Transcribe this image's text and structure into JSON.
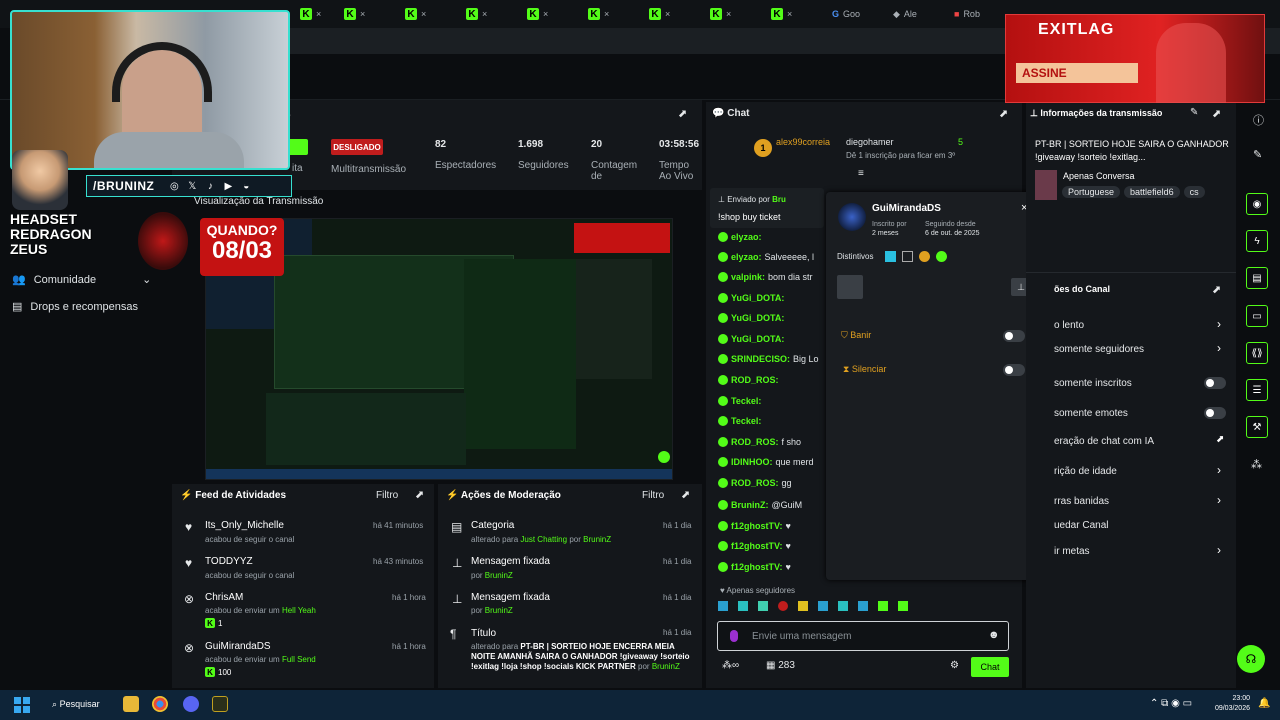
{
  "browser": {
    "tabs": [
      "Goo",
      "Ale",
      "Rob"
    ],
    "kick_tab_count": 13
  },
  "overlay": {
    "handle": "/BRUNINZ",
    "headset_lines": [
      "HEADSET",
      "REDRAGON",
      "ZEUS"
    ],
    "quando": "QUANDO?",
    "date": "08/03",
    "ad_brand": "EXITLAG",
    "ad_button": "ASSINE"
  },
  "leftnav": {
    "community": "Comunidade",
    "drops": "Drops e recompensas"
  },
  "streaminfo": {
    "desligado": "DESLIGADO",
    "multistream": "Multitransmissão",
    "viewers_value": "82",
    "viewers_label": "Espectadores",
    "followers_value": "1.698",
    "followers_label": "Seguidores",
    "count_value": "20",
    "count_label": "Contagem de",
    "time_value": "03:58:56",
    "time_label": "Tempo Ao Vivo",
    "preview_title": "Visualização da Transmissão",
    "partial_label": "o",
    "partial_left": "ita"
  },
  "feed": {
    "title": "Feed de Atividades",
    "filter": "Filtro",
    "items": [
      {
        "name": "Its_Only_Michelle",
        "sub": "acabou de seguir o canal",
        "time": "há 41 minutos"
      },
      {
        "name": "TODDYYZ",
        "sub": "acabou de seguir o canal",
        "time": "há 43 minutos"
      },
      {
        "name": "ChrisAM",
        "sub": "acabou de enviar um",
        "sub_highlight": "Hell Yeah",
        "count": "1",
        "time": "há 1 hora"
      },
      {
        "name": "GuiMirandaDS",
        "sub": "acabou de enviar um",
        "sub_highlight": "Full Send",
        "count": "100",
        "time": "há 1 hora"
      }
    ]
  },
  "modactions": {
    "title": "Ações de Moderação",
    "filter": "Filtro",
    "items": [
      {
        "title": "Categoria",
        "sub_prefix": "alterado para",
        "sub_highlight": "Just Chatting",
        "sub_mid": "por",
        "sub_user": "BruninZ",
        "time": "há 1 dia"
      },
      {
        "title": "Mensagem fixada",
        "sub_prefix": "por",
        "sub_user": "BruninZ",
        "time": "há 1 dia"
      },
      {
        "title": "Mensagem fixada",
        "sub_prefix": "por",
        "sub_user": "BruninZ",
        "time": "há 1 dia"
      },
      {
        "title": "Título",
        "sub_prefix": "alterado para",
        "sub_highlight": "PT-BR | SORTEIO HOJE ENCERRA MEIA NOITE AMANHÃ SAIRA O GANHADOR !giveaway !sorteio !exitlag !loja !shop !socials",
        "sub_mid": "KICK PARTNER",
        "sub_user": "BruninZ",
        "sub_after": "por",
        "time": "há 1 dia"
      }
    ]
  },
  "chat": {
    "title": "Chat",
    "gifters": [
      {
        "name": "alex99correia",
        "count": "1"
      },
      {
        "name": "diegohamer",
        "count": "5"
      }
    ],
    "gift_note": "Dê 1 inscrição para ficar em 3º",
    "pinned_label": "Enviado por",
    "pinned_user": "Bru",
    "pinned_msg": "!shop buy ticket",
    "lines": [
      {
        "user": "elyzao:",
        "msg": ""
      },
      {
        "user": "elyzao:",
        "msg": "Salveeeee, l"
      },
      {
        "user": "valpink:",
        "msg": "bom dia str"
      },
      {
        "user": "YuGi_DOTA:",
        "msg": ""
      },
      {
        "user": "YuGi_DOTA:",
        "msg": ""
      },
      {
        "user": "YuGi_DOTA:",
        "msg": ""
      },
      {
        "user": "SRINDECISO:",
        "msg": "Big Lo"
      },
      {
        "user": "ROD_ROS:",
        "msg": ""
      },
      {
        "user": "Teckel:",
        "msg": ""
      },
      {
        "user": "Teckel:",
        "msg": ""
      },
      {
        "user": "ROD_ROS:",
        "msg": "f sho"
      },
      {
        "user": "IDINHOO:",
        "msg": "que merd"
      },
      {
        "user": "ROD_ROS:",
        "msg": "gg"
      },
      {
        "user": "BruninZ:",
        "msg": "@GuiM"
      },
      {
        "user": "f12ghostTV:",
        "msg": "♥"
      },
      {
        "user": "f12ghostTV:",
        "msg": "♥"
      },
      {
        "user": "f12ghostTV:",
        "msg": "♥"
      }
    ],
    "followers_only": "Apenas seguidores",
    "input_placeholder": "Envie uma mensagem",
    "points": "283",
    "send": "Chat"
  },
  "usercard": {
    "name": "GuiMirandaDS",
    "sub_label": "Inscrito por",
    "sub_value": "2 meses",
    "follow_label": "Seguindo desde",
    "follow_value": "6 de out. de 2025",
    "badges_label": "Distintivos",
    "ban": "Banir",
    "mute": "Silenciar"
  },
  "info": {
    "title": "Informações da transmissão",
    "stream_title": "PT-BR | SORTEIO HOJE SAIRA O GANHADOR !giveaway !sorteio !exitlag...",
    "category": "Apenas Conversa",
    "tags": [
      "Portuguese",
      "battlefield6",
      "cs"
    ],
    "actions_title": "ões do Canal",
    "modes": [
      {
        "label": "o lento",
        "control": "chevron"
      },
      {
        "label": "somente seguidores",
        "control": "chevron"
      },
      {
        "label": "somente inscritos",
        "control": "toggle"
      },
      {
        "label": "somente emotes",
        "control": "toggle"
      },
      {
        "label": "eração de chat com IA",
        "control": "link"
      },
      {
        "label": "rição de idade",
        "control": "chevron"
      },
      {
        "label": "rras banidas",
        "control": "chevron"
      },
      {
        "label": "uedar Canal",
        "control": "none"
      },
      {
        "label": "ir metas",
        "control": "chevron"
      }
    ]
  },
  "taskbar": {
    "search": "Pesquisar",
    "time": "23:00",
    "date": "09/03/2026"
  },
  "colors": {
    "kick_green": "#53fc18",
    "bg": "#0b0d10",
    "panel": "#14171b",
    "red": "#c01d1d"
  }
}
